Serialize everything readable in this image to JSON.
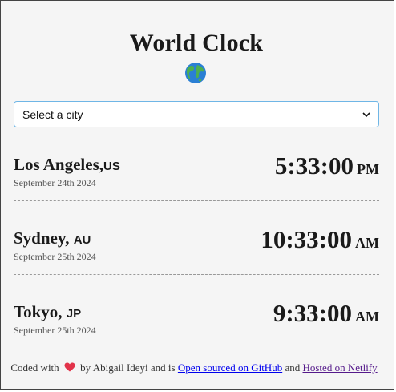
{
  "header": {
    "title": "World Clock",
    "globe_icon": "globe-icon"
  },
  "city_select": {
    "selected": "Select a city"
  },
  "cities": [
    {
      "name": "Los Angeles,",
      "country": "US",
      "date": "September 24th 2024",
      "time": "5:33:00",
      "ampm": "PM"
    },
    {
      "name": "Sydney, ",
      "country": "AU",
      "date": "September 25th 2024",
      "time": "10:33:00",
      "ampm": "AM"
    },
    {
      "name": "Tokyo, ",
      "country": "JP",
      "date": "September 25th 2024",
      "time": "9:33:00",
      "ampm": "AM"
    }
  ],
  "footer": {
    "coded_with": "Coded with",
    "heart_icon": "heart-icon",
    "by_text": "by Abigail Ideyi and is",
    "github_link": "Open sourced on GitHub",
    "and_text": "and",
    "netlify_link": "Hosted on Netlify"
  },
  "colors": {
    "select_border": "#6fb6e6",
    "heart": "#e2334a",
    "link": "#0000ee",
    "visited_link": "#551a8b"
  }
}
